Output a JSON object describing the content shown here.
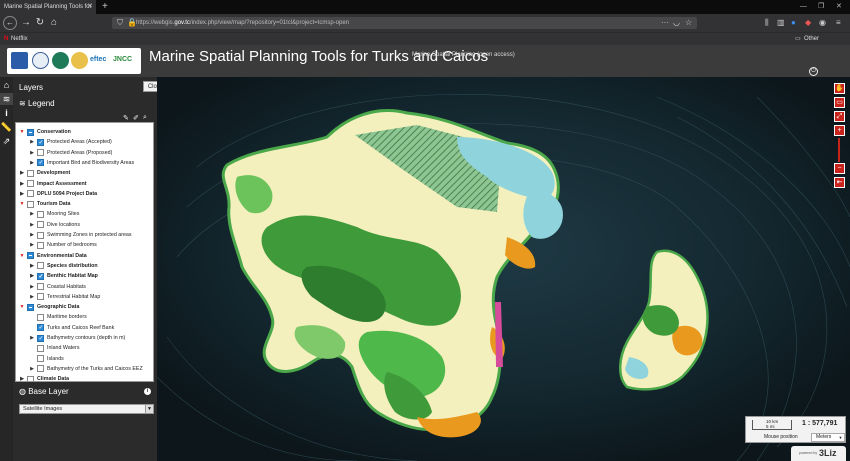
{
  "browser": {
    "tab_title": "Marine Spatial Planning Tools for",
    "url_prefix": "https://webgis.",
    "url_host": "gov.tc",
    "url_suffix": "/index.php/view/map/?repository=01tcl&project=tcmsp-open",
    "bookmark_netflix": "Netflix",
    "bookmark_other": "Other Bookmarks"
  },
  "header": {
    "title": "Marine Spatial Planning Tools for Turks and Caicos",
    "subtitle": "Marine Spatial Planning (open access)",
    "logo_eftec": "eftec",
    "logo_jncc": "JNCC"
  },
  "panel": {
    "layers_label": "Layers",
    "close_label": "Close",
    "legend_label": "Legend",
    "base_layer_label": "Base Layer",
    "base_layer_value": "Satellite Images",
    "info": "i"
  },
  "tree": [
    {
      "label": "Conservation",
      "level": 0,
      "bold": true,
      "arrow": "open",
      "cb": "part"
    },
    {
      "label": "Protected Areas (Accepted)",
      "level": 1,
      "arrow": "closed",
      "cb": "on"
    },
    {
      "label": "Protected Areas (Proposed)",
      "level": 1,
      "arrow": "closed",
      "cb": "off"
    },
    {
      "label": "Important Bird and Biodiversity Areas",
      "level": 1,
      "arrow": "closed",
      "cb": "on"
    },
    {
      "label": "Development",
      "level": 0,
      "bold": true,
      "arrow": "closed",
      "cb": "off"
    },
    {
      "label": "Impact Assessment",
      "level": 0,
      "bold": true,
      "arrow": "closed",
      "cb": "off"
    },
    {
      "label": "DPLU 5094 Project Data",
      "level": 0,
      "bold": true,
      "arrow": "closed",
      "cb": "off"
    },
    {
      "label": "Tourism Data",
      "level": 0,
      "bold": true,
      "arrow": "open",
      "cb": "off"
    },
    {
      "label": "Mooring Sites",
      "level": 1,
      "arrow": "closed",
      "cb": "off"
    },
    {
      "label": "Dive locations",
      "level": 1,
      "arrow": "closed",
      "cb": "off"
    },
    {
      "label": "Swimming Zones in protected areas",
      "level": 1,
      "arrow": "closed",
      "cb": "off"
    },
    {
      "label": "Number of bedrooms",
      "level": 1,
      "arrow": "closed",
      "cb": "off"
    },
    {
      "label": "Environmental Data",
      "level": 0,
      "bold": true,
      "arrow": "open",
      "cb": "part"
    },
    {
      "label": "Species distribution",
      "level": 1,
      "bold": true,
      "arrow": "closed",
      "cb": "off"
    },
    {
      "label": "Benthic Habitat Map",
      "level": 1,
      "bold": true,
      "arrow": "closed",
      "cb": "on"
    },
    {
      "label": "Coastal Habitats",
      "level": 1,
      "arrow": "closed",
      "cb": "off"
    },
    {
      "label": "Terrestrial Habitat Map",
      "level": 1,
      "arrow": "closed",
      "cb": "off"
    },
    {
      "label": "Geographic Data",
      "level": 0,
      "bold": true,
      "arrow": "open",
      "cb": "part"
    },
    {
      "label": "Maritime borders",
      "level": 1,
      "arrow": "none",
      "cb": "off"
    },
    {
      "label": "Turks and Caicos Reef Bank",
      "level": 1,
      "arrow": "none",
      "cb": "on"
    },
    {
      "label": "Bathymetry contours (depth in m)",
      "level": 1,
      "arrow": "closed",
      "cb": "on"
    },
    {
      "label": "Inland Waters",
      "level": 1,
      "arrow": "none",
      "cb": "off"
    },
    {
      "label": "Islands",
      "level": 1,
      "arrow": "none",
      "cb": "off"
    },
    {
      "label": "Bathymetry of the Turks and Caicos EEZ",
      "level": 1,
      "arrow": "closed",
      "cb": "off"
    },
    {
      "label": "Climate Data",
      "level": 0,
      "bold": true,
      "arrow": "closed",
      "cb": "off"
    }
  ],
  "scale": {
    "km": "10 km",
    "mi": "5 mi",
    "ratio": "1 : 577,791",
    "mouse_position": "Mouse position",
    "units": "Meters"
  },
  "poweredby": {
    "text": "powered by",
    "logo": "3Liz"
  }
}
